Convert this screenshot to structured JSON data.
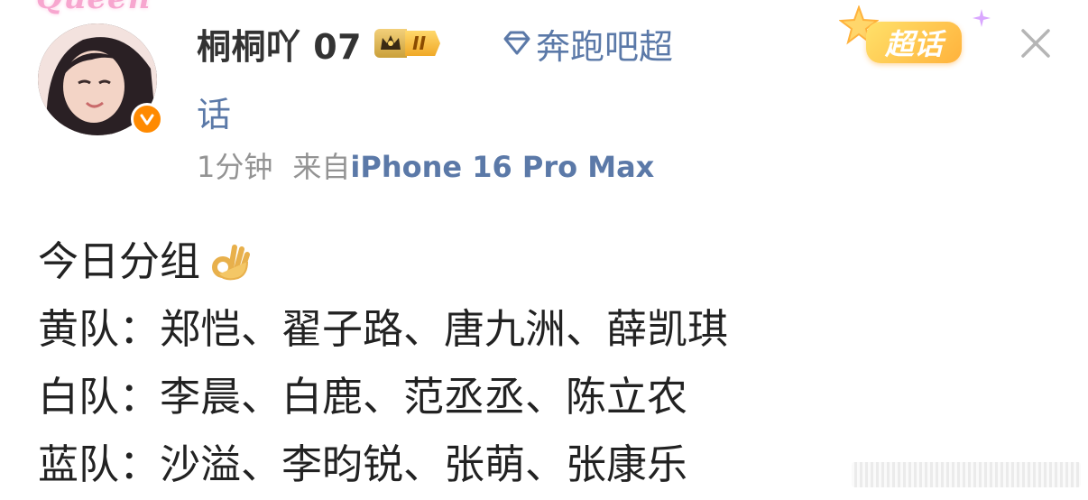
{
  "header": {
    "frame_text": "Queen",
    "username": "桐桐吖 07",
    "level_badge": "II",
    "topic_first": "奔跑吧超",
    "topic_rest": "话",
    "time": "1分钟",
    "source_prefix": "来自",
    "device": "iPhone 16 Pro Max",
    "supertopic_label": "超话"
  },
  "post": {
    "lines": [
      "今日分组",
      "黄队：郑恺、翟子路、唐九洲、薛凯琪",
      "白队：李晨、白鹿、范丞丞、陈立农",
      "蓝队：沙溢、李昀锐、张萌、张康乐"
    ]
  },
  "colors": {
    "link": "#5b79a8",
    "meta": "#939393",
    "verified": "#ff8a00",
    "badge": "#f0a928"
  },
  "icons": [
    "avatar",
    "verified-icon",
    "crown-icon",
    "diamond-icon",
    "supertopic-icon",
    "close-icon",
    "ok-hand-emoji"
  ]
}
